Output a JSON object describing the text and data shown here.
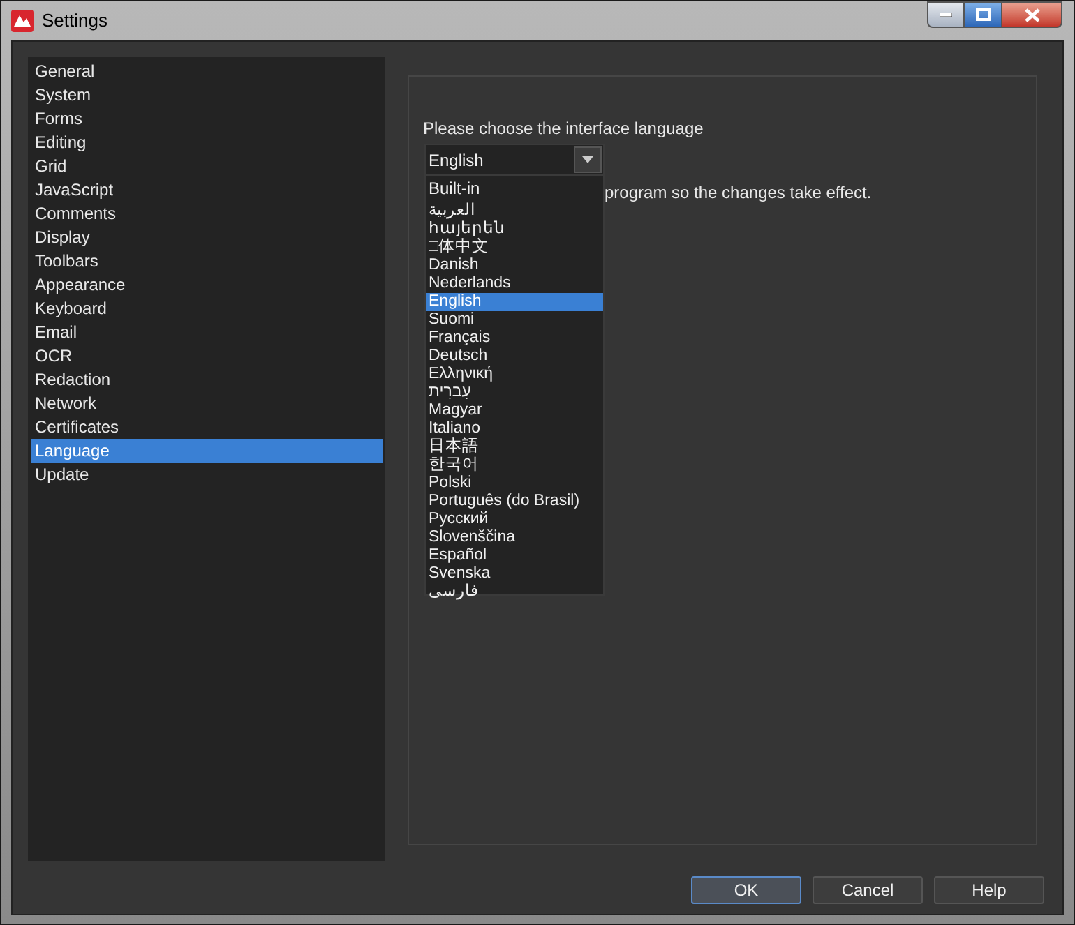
{
  "window": {
    "title": "Settings"
  },
  "sidebar": {
    "items": [
      {
        "label": "General",
        "selected": false
      },
      {
        "label": "System",
        "selected": false
      },
      {
        "label": "Forms",
        "selected": false
      },
      {
        "label": "Editing",
        "selected": false
      },
      {
        "label": "Grid",
        "selected": false
      },
      {
        "label": "JavaScript",
        "selected": false
      },
      {
        "label": "Comments",
        "selected": false
      },
      {
        "label": "Display",
        "selected": false
      },
      {
        "label": "Toolbars",
        "selected": false
      },
      {
        "label": "Appearance",
        "selected": false
      },
      {
        "label": "Keyboard",
        "selected": false
      },
      {
        "label": "Email",
        "selected": false
      },
      {
        "label": "OCR",
        "selected": false
      },
      {
        "label": "Redaction",
        "selected": false
      },
      {
        "label": "Network",
        "selected": false
      },
      {
        "label": "Certificates",
        "selected": false
      },
      {
        "label": "Language",
        "selected": true
      },
      {
        "label": "Update",
        "selected": false
      }
    ]
  },
  "language": {
    "label": "Please choose the interface language",
    "value": "English",
    "note": "program so the changes take effect.",
    "dropdown": {
      "header": "Built-in",
      "options": [
        {
          "label": "العربية",
          "selected": false
        },
        {
          "label": "հայերեն",
          "selected": false
        },
        {
          "label": "□体中文",
          "selected": false
        },
        {
          "label": "Danish",
          "selected": false
        },
        {
          "label": "Nederlands",
          "selected": false
        },
        {
          "label": "English",
          "selected": true
        },
        {
          "label": "Suomi",
          "selected": false
        },
        {
          "label": "Français",
          "selected": false
        },
        {
          "label": "Deutsch",
          "selected": false
        },
        {
          "label": "Ελληνική",
          "selected": false
        },
        {
          "label": "עִברִית",
          "selected": false
        },
        {
          "label": "Magyar",
          "selected": false
        },
        {
          "label": "Italiano",
          "selected": false
        },
        {
          "label": "日本語",
          "selected": false
        },
        {
          "label": "한국어",
          "selected": false
        },
        {
          "label": "Polski",
          "selected": false
        },
        {
          "label": "Português (do Brasil)",
          "selected": false
        },
        {
          "label": "Русский",
          "selected": false
        },
        {
          "label": "Slovenščina",
          "selected": false
        },
        {
          "label": "Español",
          "selected": false
        },
        {
          "label": "Svenska",
          "selected": false
        },
        {
          "label": "فارسی",
          "selected": false
        }
      ]
    }
  },
  "buttons": [
    {
      "label": "OK",
      "kind": "default"
    },
    {
      "label": "Cancel",
      "kind": "normal"
    },
    {
      "label": "Help",
      "kind": "normal"
    }
  ]
}
